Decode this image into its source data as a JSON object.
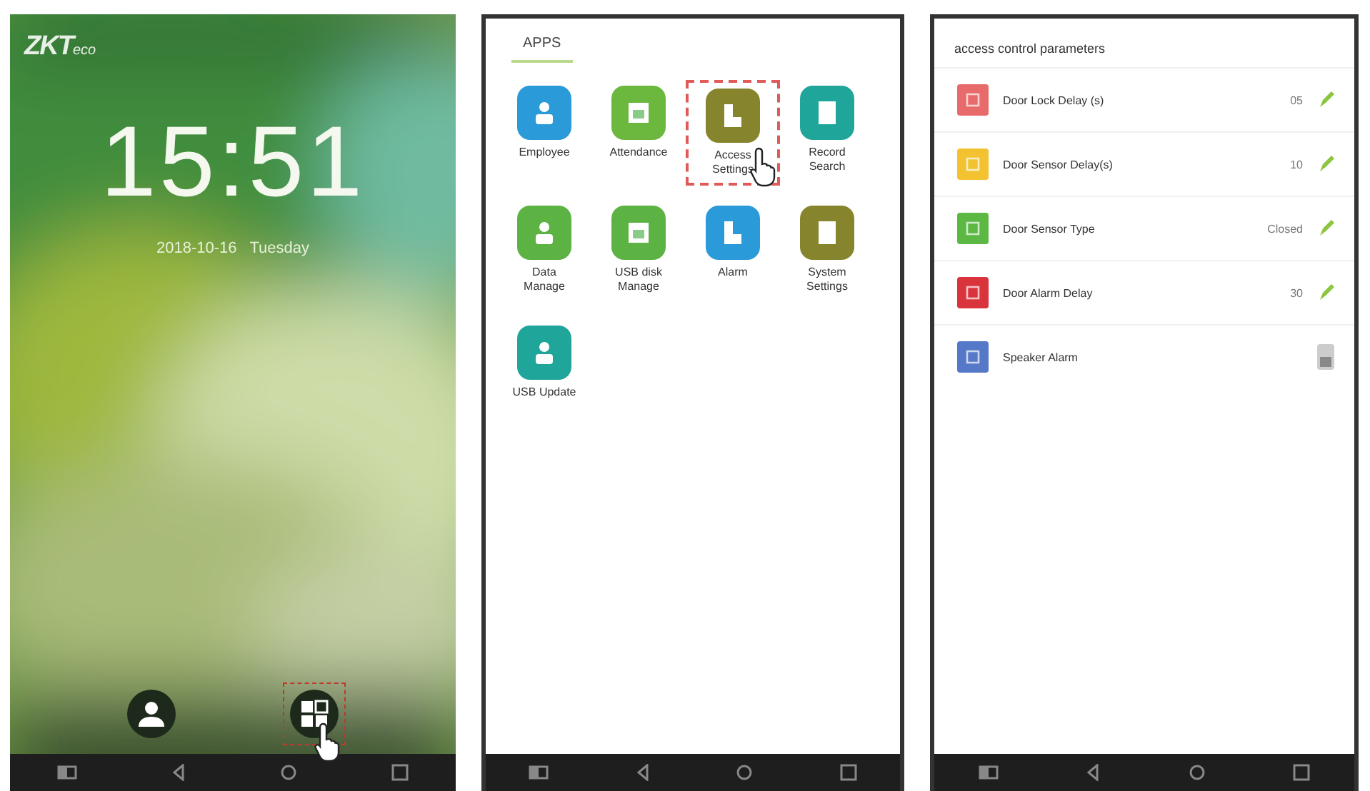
{
  "screens": [
    {
      "kind": "home",
      "logo": {
        "brand": "ZKT",
        "suffix": "eco"
      },
      "time": "15:51",
      "date": "2018-10-16   Tuesday",
      "dock": [
        {
          "kind": "user",
          "highlighted": false
        },
        {
          "kind": "apps",
          "highlighted": true
        }
      ]
    },
    {
      "kind": "apps",
      "title": "APPS",
      "apps": [
        {
          "label": "Employee",
          "color": "#2a9ad8",
          "highlighted": false
        },
        {
          "label": "Attendance",
          "color": "#6cb83f",
          "highlighted": false
        },
        {
          "label": "Access\nSettings",
          "color": "#86842c",
          "highlighted": true
        },
        {
          "label": "Record\nSearch",
          "color": "#1fa59a",
          "highlighted": false
        },
        {
          "label": "Data\nManage",
          "color": "#5cb243",
          "highlighted": false
        },
        {
          "label": "USB disk\nManage",
          "color": "#5cb243",
          "highlighted": false
        },
        {
          "label": "Alarm",
          "color": "#2a9ad8",
          "highlighted": false
        },
        {
          "label": "System\nSettings",
          "color": "#86842c",
          "highlighted": false
        },
        {
          "label": "USB Update",
          "color": "#1fa59a",
          "highlighted": false
        }
      ]
    },
    {
      "kind": "params",
      "title": "access control parameters",
      "rows": [
        {
          "kind": "value",
          "label": "Door Lock Delay (s)",
          "value": "05",
          "color": "#e86a6a"
        },
        {
          "kind": "value",
          "label": "Door Sensor Delay(s)",
          "value": "10",
          "color": "#f2c230"
        },
        {
          "kind": "value",
          "label": "Door Sensor Type",
          "value": "Closed",
          "color": "#5cb843"
        },
        {
          "kind": "value",
          "label": "Door Alarm Delay",
          "value": "30",
          "color": "#d9343c"
        },
        {
          "kind": "switch",
          "label": "Speaker Alarm",
          "on": false,
          "color": "#5578c8"
        }
      ]
    }
  ]
}
